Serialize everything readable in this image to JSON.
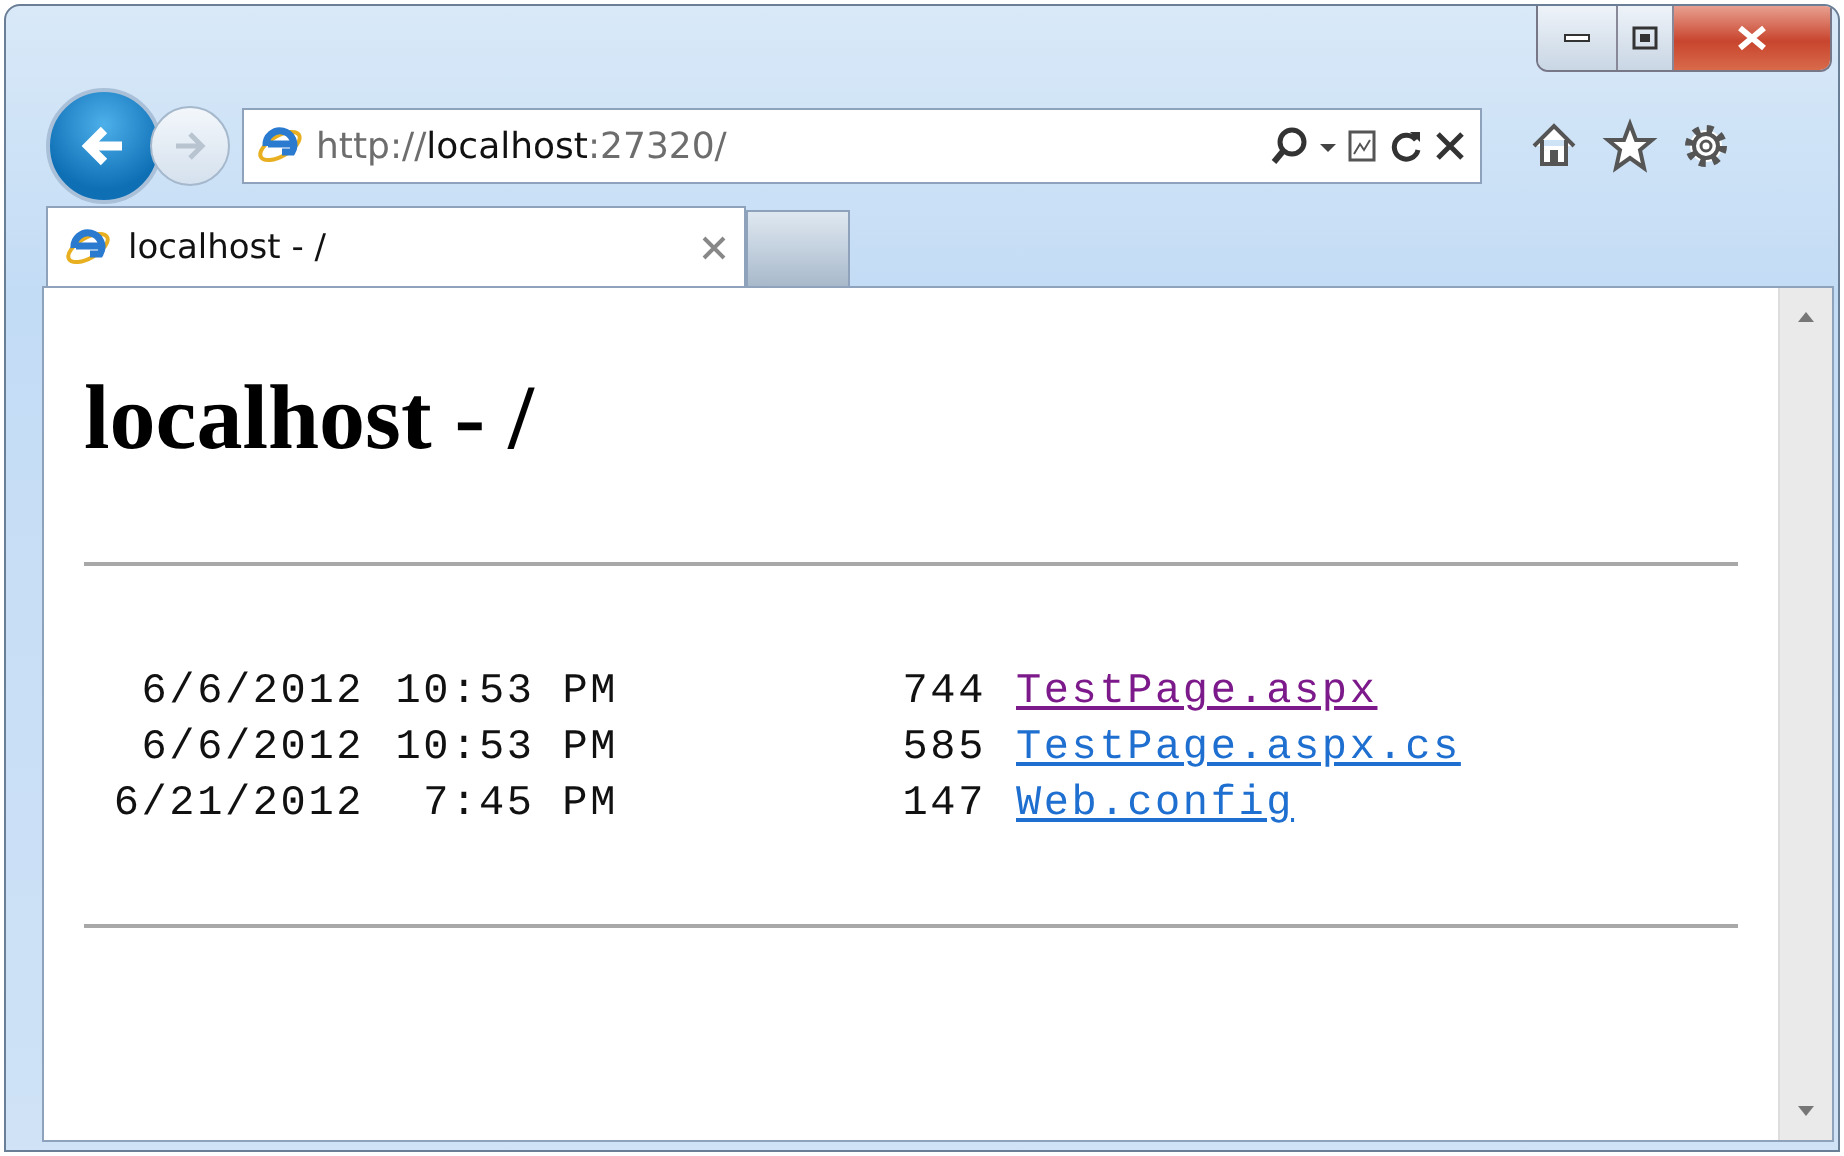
{
  "address_bar": {
    "url": "http://**localhost**:27320/"
  },
  "tabs": [
    {
      "title": "localhost - /",
      "selected": true
    }
  ],
  "page": {
    "heading": "localhost - /",
    "listing": [
      {
        "date": "6/6/2012",
        "time": "10:53 PM",
        "size": "744",
        "name": "TestPage.aspx",
        "visited": true
      },
      {
        "date": "6/6/2012",
        "time": "10:53 PM",
        "size": "585",
        "name": "TestPage.aspx.cs",
        "visited": false
      },
      {
        "date": "6/21/2012",
        "time": "7:45 PM",
        "size": "147",
        "name": "Web.config",
        "visited": false
      }
    ]
  }
}
